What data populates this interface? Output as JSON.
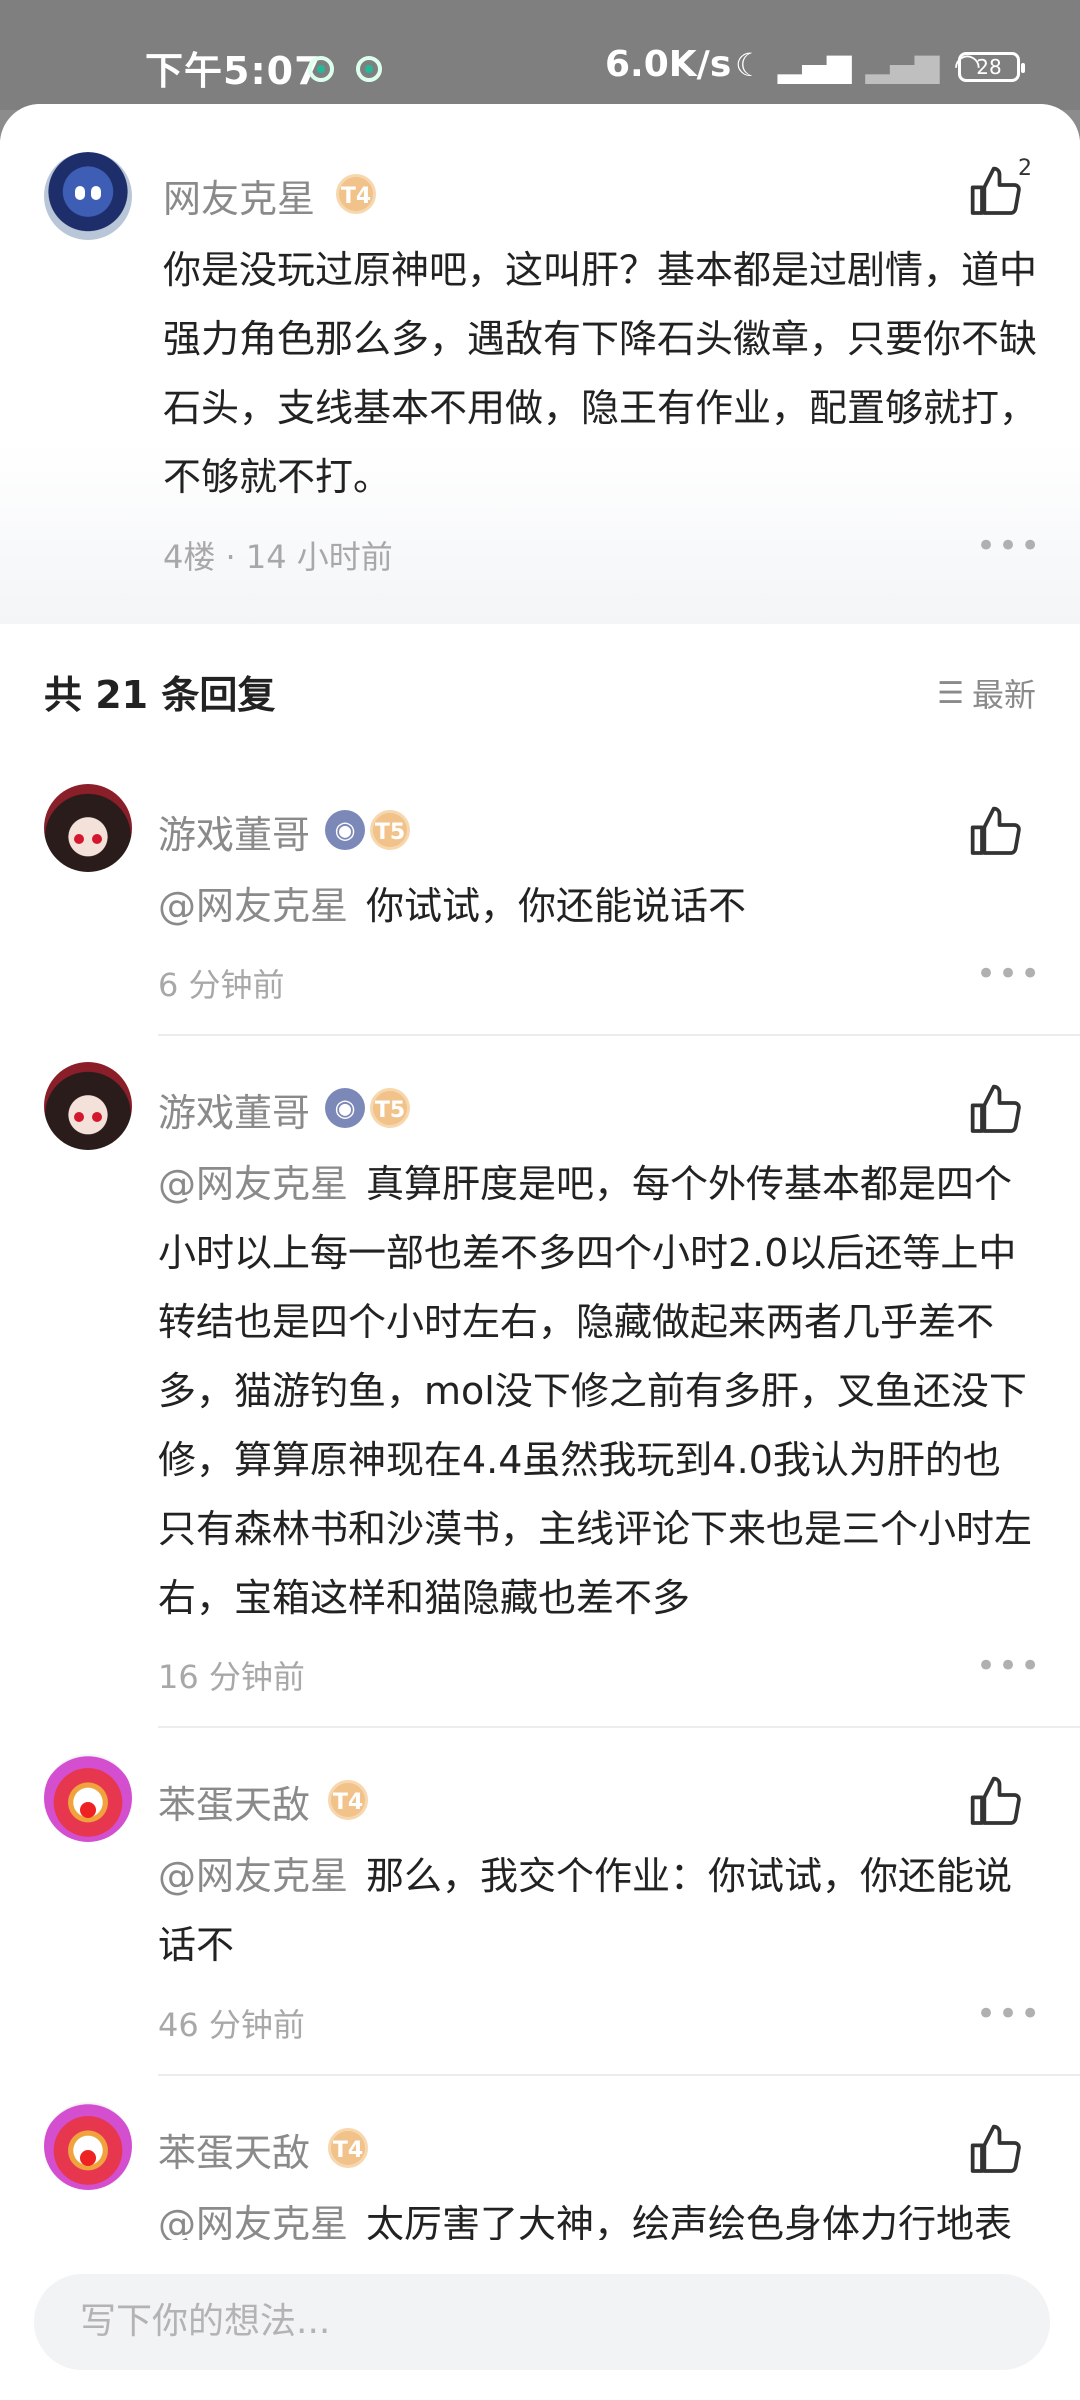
{
  "status_bar": {
    "time": "下午5:07",
    "net_speed": "6.0K/s",
    "battery": "28"
  },
  "top_comment": {
    "user": "网友克星",
    "level_badge": "T4",
    "likes": "2",
    "text": "你是没玩过原神吧，这叫肝？基本都是过剧情，道中强力角色那么多，遇敌有下降石头徽章，只要你不缺石头，支线基本不用做，隐王有作业，配置够就打，不够就不打。",
    "meta": "4楼 · 14 小时前"
  },
  "replies_header": {
    "count_label": "共 21 条回复",
    "sort_label": "最新"
  },
  "replies": [
    {
      "user": "游戏董哥",
      "level_badge": "T5",
      "mention": "@网友克星",
      "text": "你试试，你还能说话不",
      "time": "6 分钟前"
    },
    {
      "user": "游戏董哥",
      "level_badge": "T5",
      "mention": "@网友克星",
      "text": "真算肝度是吧，每个外传基本都是四个小时以上每一部也差不多四个小时2.0以后还等上中转结也是四个小时左右，隐藏做起来两者几乎差不多，猫游钓鱼，mol没下修之前有多肝，叉鱼还没下修，算算原神现在4.4虽然我玩到4.0我认为肝的也只有森林书和沙漠书，主线评论下来也是三个小时左右，宝箱这样和猫隐藏也差不多",
      "time": "16 分钟前"
    },
    {
      "user": "苯蛋天敌",
      "level_badge": "T4",
      "mention": "@网友克星",
      "text": "那么，我交个作业：你试试，你还能说话不",
      "time": "46 分钟前"
    },
    {
      "user": "苯蛋天敌",
      "level_badge": "T4",
      "mention": "@网友克星",
      "text": "太厉害了大神，绘声绘色身体力行地表"
    }
  ],
  "input": {
    "placeholder": "写下你的想法..."
  },
  "icons": {
    "like": "thumbs-up-icon",
    "more": "more-dots-icon",
    "sort": "sort-list-icon"
  },
  "colors": {
    "accent_gray": "#8a8a8a",
    "badge_gold": "#f1c28a"
  }
}
